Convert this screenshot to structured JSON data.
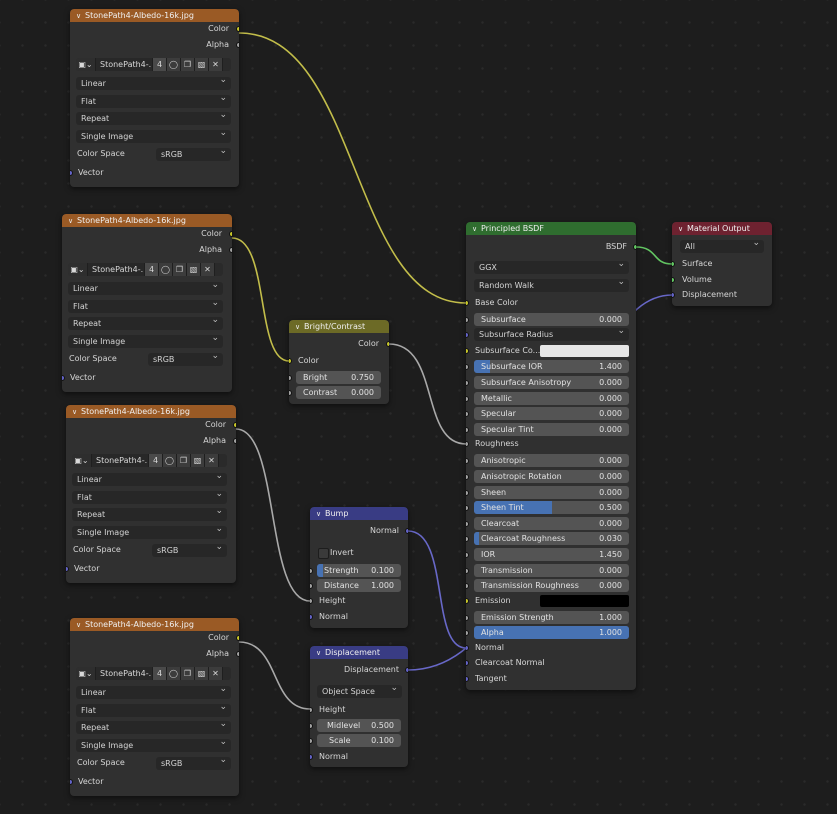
{
  "image_node": {
    "title": "StonePath4-Albedo-16k.jpg",
    "out_color": "Color",
    "out_alpha": "Alpha",
    "image_name": "StonePath4-...",
    "users": "4",
    "interpolation": "Linear",
    "projection": "Flat",
    "extension": "Repeat",
    "source": "Single Image",
    "color_space_label": "Color Space",
    "color_space_value": "sRGB",
    "in_vector": "Vector",
    "icons": [
      "image-icon",
      "shield-icon",
      "duplicate-icon",
      "folder-icon",
      "close-icon"
    ]
  },
  "bright_contrast": {
    "title": "Bright/Contrast",
    "out_color": "Color",
    "in_color": "Color",
    "bright_label": "Bright",
    "bright_value": "0.750",
    "contrast_label": "Contrast",
    "contrast_value": "0.000"
  },
  "bump": {
    "title": "Bump",
    "out_normal": "Normal",
    "invert_label": "Invert",
    "strength_label": "Strength",
    "strength_value": "0.100",
    "distance_label": "Distance",
    "distance_value": "1.000",
    "in_height": "Height",
    "in_normal": "Normal"
  },
  "displacement": {
    "title": "Displacement",
    "out_displacement": "Displacement",
    "space": "Object Space",
    "in_height": "Height",
    "midlevel_label": "Midlevel",
    "midlevel_value": "0.500",
    "scale_label": "Scale",
    "scale_value": "0.100",
    "in_normal": "Normal"
  },
  "principled": {
    "title": "Principled BSDF",
    "out_bsdf": "BSDF",
    "distribution": "GGX",
    "subsurface_method": "Random Walk",
    "base_color": "Base Color",
    "subsurface": {
      "label": "Subsurface",
      "value": "0.000"
    },
    "subsurface_radius": "Subsurface Radius",
    "subsurface_color": "Subsurface Co...",
    "subsurface_ior": {
      "label": "Subsurface IOR",
      "value": "1.400",
      "fill": 0.1
    },
    "subsurface_anisotropy": {
      "label": "Subsurface Anisotropy",
      "value": "0.000"
    },
    "metallic": {
      "label": "Metallic",
      "value": "0.000"
    },
    "specular": {
      "label": "Specular",
      "value": "0.000"
    },
    "specular_tint": {
      "label": "Specular Tint",
      "value": "0.000"
    },
    "roughness": "Roughness",
    "anisotropic": {
      "label": "Anisotropic",
      "value": "0.000"
    },
    "anisotropic_rotation": {
      "label": "Anisotropic Rotation",
      "value": "0.000"
    },
    "sheen": {
      "label": "Sheen",
      "value": "0.000"
    },
    "sheen_tint": {
      "label": "Sheen Tint",
      "value": "0.500",
      "fill": 0.5
    },
    "clearcoat": {
      "label": "Clearcoat",
      "value": "0.000"
    },
    "clearcoat_roughness": {
      "label": "Clearcoat Roughness",
      "value": "0.030",
      "fill": 0.03
    },
    "ior": {
      "label": "IOR",
      "value": "1.450"
    },
    "transmission": {
      "label": "Transmission",
      "value": "0.000"
    },
    "transmission_roughness": {
      "label": "Transmission Roughness",
      "value": "0.000"
    },
    "emission": "Emission",
    "emission_strength": {
      "label": "Emission Strength",
      "value": "1.000"
    },
    "alpha": {
      "label": "Alpha",
      "value": "1.000",
      "fill": 1.0
    },
    "normal": "Normal",
    "clearcoat_normal": "Clearcoat Normal",
    "tangent": "Tangent"
  },
  "material_output": {
    "title": "Material Output",
    "target": "All",
    "in_surface": "Surface",
    "in_volume": "Volume",
    "in_displacement": "Displacement"
  },
  "colors": {
    "color_socket": "#c7c729",
    "float_socket": "#a1a1a1",
    "vector_socket": "#6363c7",
    "shader_socket": "#63c763",
    "subsurface_color": "#e6e6e6",
    "emission_color": "#000000",
    "slider_fill": "#4772b3"
  }
}
